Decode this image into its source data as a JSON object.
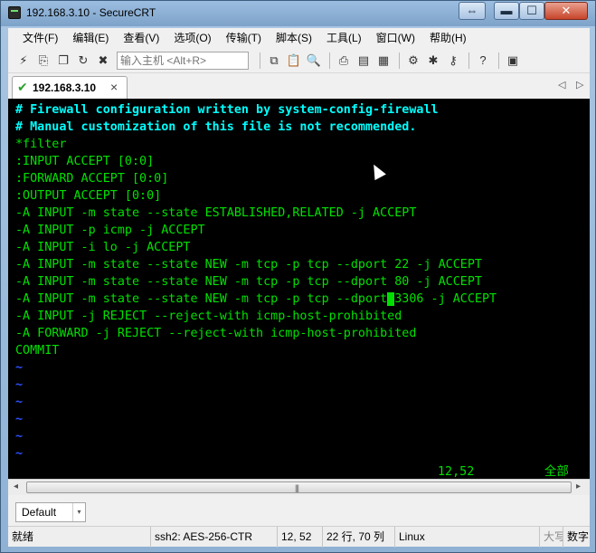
{
  "window": {
    "title": "192.168.3.10 - SecureCRT",
    "restore_glyph": "⇔",
    "min_glyph": "▬",
    "max_glyph": "☐",
    "close_glyph": "✕"
  },
  "menu": {
    "items": [
      "文件(F)",
      "编辑(E)",
      "查看(V)",
      "选项(O)",
      "传输(T)",
      "脚本(S)",
      "工具(L)",
      "窗口(W)",
      "帮助(H)"
    ]
  },
  "toolbar": {
    "quick_connect_placeholder": "输入主机 <Alt+R>",
    "icons": {
      "connect": "⚡",
      "quick_connect": "⎘",
      "connect_in_tab": "❐",
      "reconnect": "↻",
      "disconnect": "✖",
      "copy": "⧉",
      "paste": "📋",
      "find": "🔍",
      "print": "⎙",
      "print_selection": "▤",
      "print_setup": "▦",
      "session_options": "⚙",
      "global_options": "✱",
      "key": "⚷",
      "help": "?",
      "sftp": "▣"
    }
  },
  "tabs": {
    "items": [
      {
        "label": "192.168.3.10",
        "status_icon": "check-icon"
      }
    ],
    "close_glyph": "×",
    "prev_glyph": "◁",
    "next_glyph": "▷"
  },
  "terminal": {
    "lines": [
      "# Firewall configuration written by system-config-firewall",
      "# Manual customization of this file is not recommended.",
      "*filter",
      ":INPUT ACCEPT [0:0]",
      ":FORWARD ACCEPT [0:0]",
      ":OUTPUT ACCEPT [0:0]",
      "-A INPUT -m state --state ESTABLISHED,RELATED -j ACCEPT",
      "-A INPUT -p icmp -j ACCEPT",
      "-A INPUT -i lo -j ACCEPT",
      "-A INPUT -m state --state NEW -m tcp -p tcp --dport 22 -j ACCEPT",
      "-A INPUT -m state --state NEW -m tcp -p tcp --dport 80 -j ACCEPT",
      "-A INPUT -m state --state NEW -m tcp -p tcp --dport 3306 -j ACCEPT",
      "-A INPUT -j REJECT --reject-with icmp-host-prohibited",
      "-A FORWARD -j REJECT --reject-with icmp-host-prohibited",
      "COMMIT",
      "~",
      "~",
      "~",
      "~",
      "~",
      "~"
    ],
    "cursor_line": 12,
    "cursor_column": 52,
    "position_readout": "12,52",
    "scope_readout": "全部",
    "colors": {
      "comment": "#00ffff",
      "text": "#00e000",
      "tilde": "#2a50ff",
      "background": "#000000"
    }
  },
  "scrollbar": {
    "left_glyph": "◂",
    "right_glyph": "▸",
    "grip": "|||"
  },
  "buttonbar": {
    "combo_value": "Default",
    "combo_arrow": "▾"
  },
  "statusbar": {
    "ready": "就绪",
    "cipher": "ssh2: AES-256-CTR",
    "cursor_pos": "12, 52",
    "size": "22 行, 70 列",
    "terminal": "Linux",
    "caps": "大写",
    "num": "数字"
  }
}
